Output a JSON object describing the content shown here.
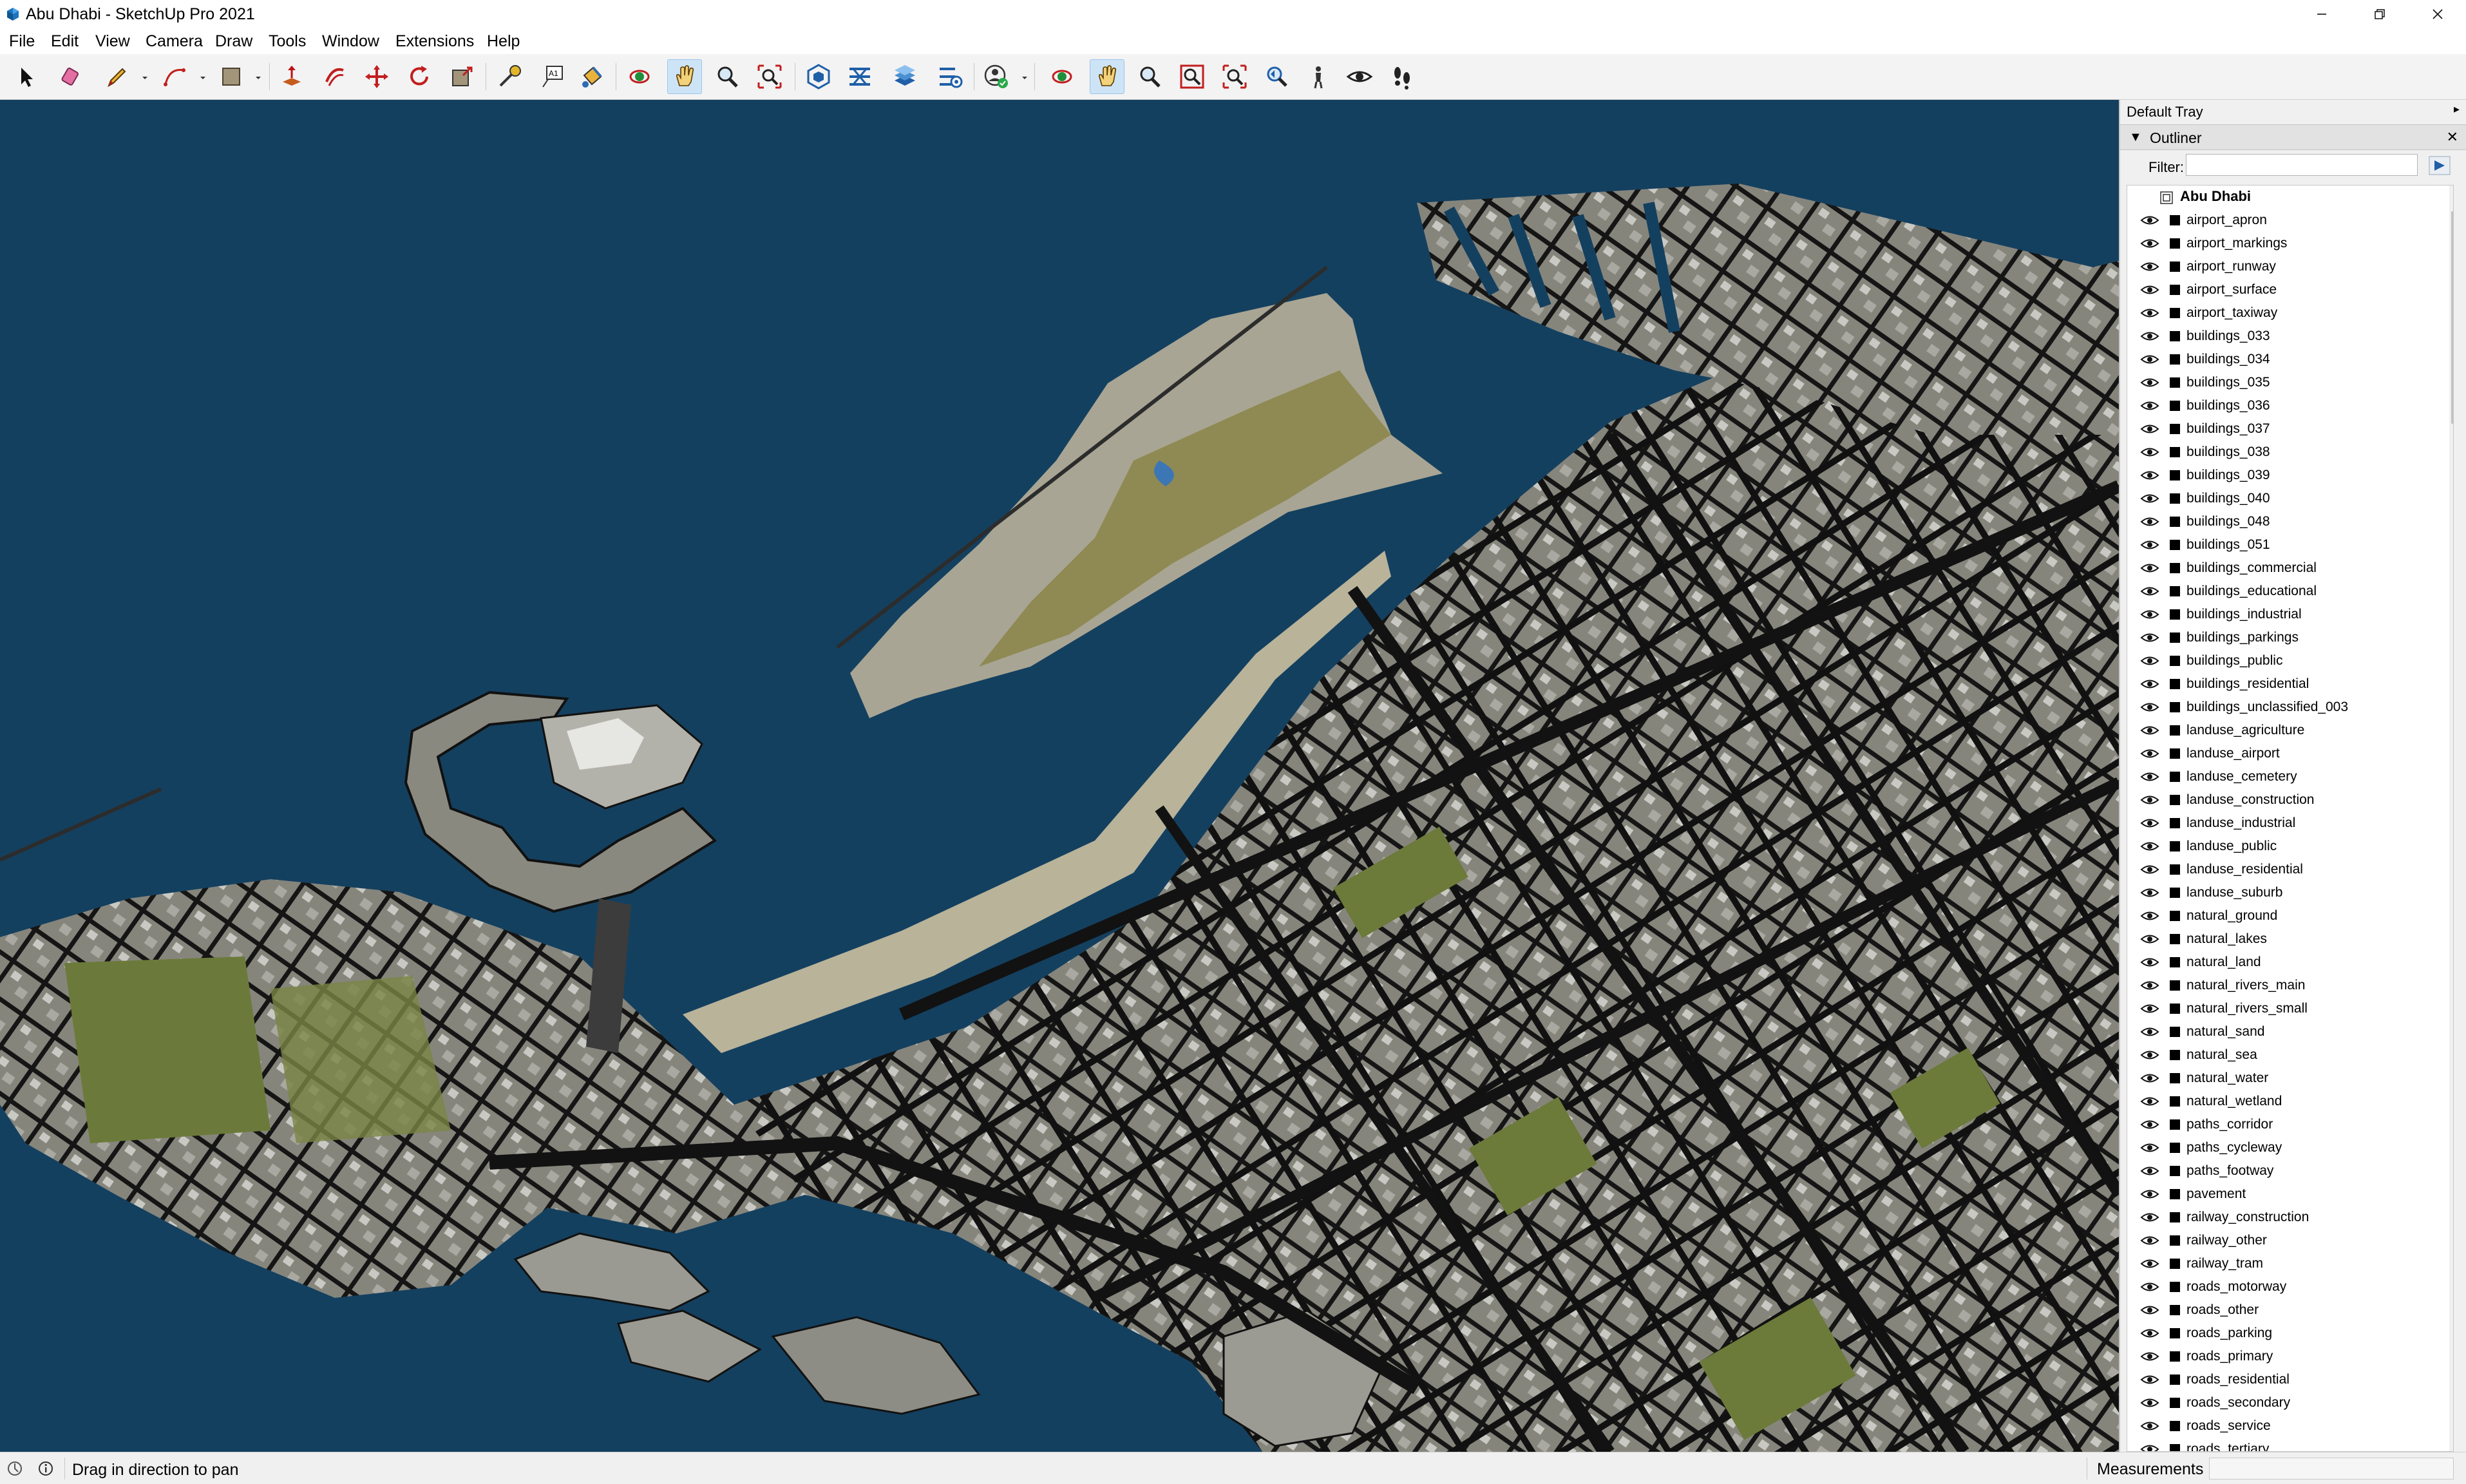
{
  "window": {
    "title": "Abu Dhabi - SketchUp Pro 2021",
    "minimize_icon": "minimize-icon",
    "maximize_icon": "restore-icon",
    "close_icon": "close-icon"
  },
  "menu": [
    "File",
    "Edit",
    "View",
    "Camera",
    "Draw",
    "Tools",
    "Window",
    "Extensions",
    "Help"
  ],
  "toolbar": {
    "tools": [
      "select-icon",
      "eraser-icon",
      "pencil-icon",
      "arc-icon",
      "rectangle-icon",
      "push-pull-icon",
      "offset-icon",
      "move-icon",
      "rotate-icon",
      "scale-icon",
      "tape-measure-icon",
      "text-icon",
      "paint-bucket-icon",
      "orbit-icon",
      "pan-icon",
      "zoom-icon",
      "zoom-extents-icon",
      "3d-warehouse-icon",
      "extension-warehouse-icon",
      "layout-icon",
      "extension-manager-icon",
      "profile-icon",
      "orbit-icon",
      "pan-icon",
      "zoom-icon",
      "zoom-window-icon",
      "zoom-extents-icon",
      "previous-view-icon",
      "position-camera-icon",
      "look-around-icon",
      "walk-icon"
    ],
    "active_tools": [
      "pan-icon"
    ]
  },
  "viewport": {
    "scene": "3D aerial model of Abu Dhabi city with water, islands, roads and buildings",
    "colors": {
      "water": "#14405f",
      "land": "#8a8a80",
      "sand": "#bdb79f",
      "green": "#6e7a3c",
      "roads": "#1a1a1a"
    }
  },
  "tray": {
    "title": "Default Tray",
    "pin_icon": "pin-icon",
    "panel": {
      "name": "Outliner",
      "filter_label": "Filter:",
      "filter_value": "",
      "root": "Abu Dhabi",
      "items": [
        "airport_apron",
        "airport_markings",
        "airport_runway",
        "airport_surface",
        "airport_taxiway",
        "buildings_033",
        "buildings_034",
        "buildings_035",
        "buildings_036",
        "buildings_037",
        "buildings_038",
        "buildings_039",
        "buildings_040",
        "buildings_048",
        "buildings_051",
        "buildings_commercial",
        "buildings_educational",
        "buildings_industrial",
        "buildings_parkings",
        "buildings_public",
        "buildings_residential",
        "buildings_unclassified_003",
        "landuse_agriculture",
        "landuse_airport",
        "landuse_cemetery",
        "landuse_construction",
        "landuse_industrial",
        "landuse_public",
        "landuse_residential",
        "landuse_suburb",
        "natural_ground",
        "natural_lakes",
        "natural_land",
        "natural_rivers_main",
        "natural_rivers_small",
        "natural_sand",
        "natural_sea",
        "natural_water",
        "natural_wetland",
        "paths_corridor",
        "paths_cycleway",
        "paths_footway",
        "pavement",
        "railway_construction",
        "railway_other",
        "railway_tram",
        "roads_motorway",
        "roads_other",
        "roads_parking",
        "roads_primary",
        "roads_residential",
        "roads_secondary",
        "roads_service",
        "roads_tertiary"
      ]
    }
  },
  "status": {
    "message": "Drag in direction to pan",
    "measurements_label": "Measurements",
    "measurements_value": ""
  }
}
